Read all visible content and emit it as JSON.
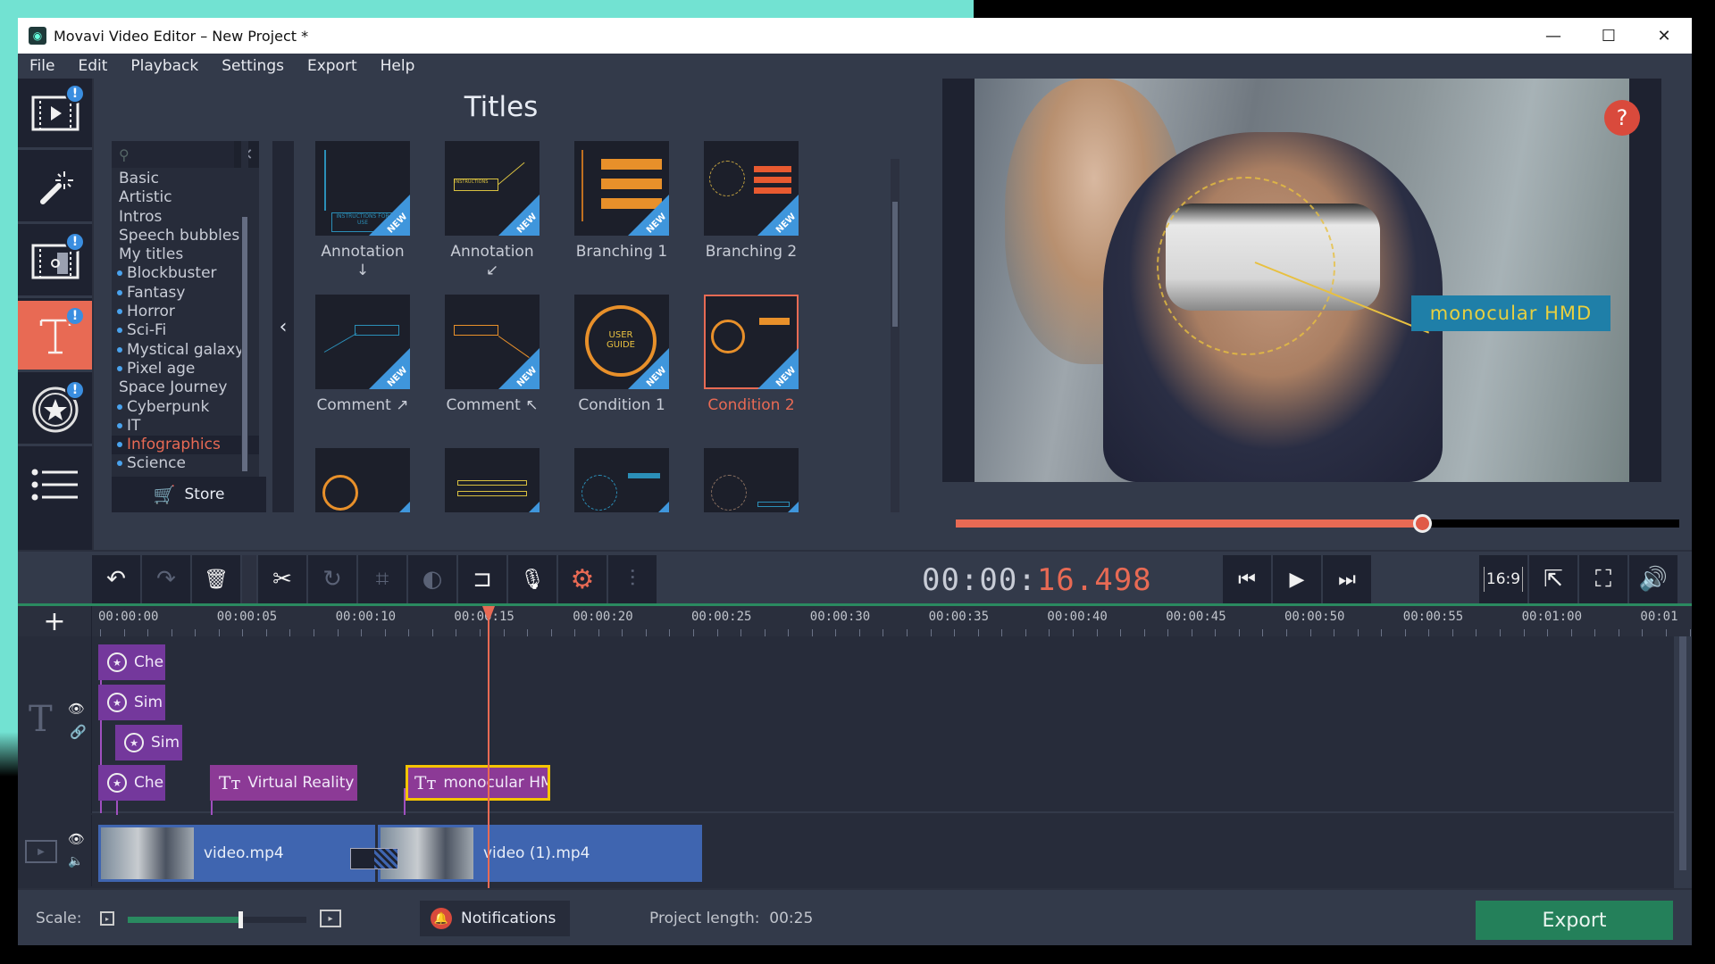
{
  "window": {
    "title": "Movavi Video Editor – New Project *",
    "controls": {
      "minimize": "—",
      "maximize": "☐",
      "close": "✕"
    }
  },
  "menu": [
    "File",
    "Edit",
    "Playback",
    "Settings",
    "Export",
    "Help"
  ],
  "sidebar": {
    "items": [
      {
        "name": "import-media",
        "icon": "film-play-icon",
        "badge": "!"
      },
      {
        "name": "filters",
        "icon": "magic-wand-icon",
        "badge": ""
      },
      {
        "name": "transitions",
        "icon": "film-puzzle-icon",
        "badge": "!"
      },
      {
        "name": "titles",
        "icon": "text-t-icon",
        "badge": "!",
        "active": true
      },
      {
        "name": "stickers",
        "icon": "star-circle-icon",
        "badge": "!"
      },
      {
        "name": "more-tools",
        "icon": "list-icon",
        "badge": ""
      }
    ]
  },
  "titles_panel": {
    "heading": "Titles",
    "search_placeholder": "",
    "categories": [
      {
        "label": "Basic",
        "dot": false
      },
      {
        "label": "Artistic",
        "dot": false
      },
      {
        "label": "Intros",
        "dot": false
      },
      {
        "label": "Speech bubbles",
        "dot": false
      },
      {
        "label": "My titles",
        "dot": false
      },
      {
        "label": "Blockbuster",
        "dot": true
      },
      {
        "label": "Fantasy",
        "dot": true
      },
      {
        "label": "Horror",
        "dot": true
      },
      {
        "label": "Sci-Fi",
        "dot": true
      },
      {
        "label": "Mystical galaxy",
        "dot": true
      },
      {
        "label": "Pixel age",
        "dot": true
      },
      {
        "label": "Space Journey",
        "dot": false
      },
      {
        "label": "Cyberpunk",
        "dot": true
      },
      {
        "label": "IT",
        "dot": true
      },
      {
        "label": "Infographics",
        "dot": true,
        "active": true
      },
      {
        "label": "Science",
        "dot": true
      }
    ],
    "store_label": "Store",
    "new_badge": "NEW",
    "tiles": [
      {
        "label": "Annotation ↓",
        "new": true
      },
      {
        "label": "Annotation ↙",
        "new": true
      },
      {
        "label": "Branching 1",
        "new": true
      },
      {
        "label": "Branching 2",
        "new": true
      },
      {
        "label": "Comment ↗",
        "new": true
      },
      {
        "label": "Comment ↖",
        "new": true
      },
      {
        "label": "Condition 1",
        "new": true
      },
      {
        "label": "Condition 2",
        "new": true,
        "selected": true
      },
      {
        "label": "",
        "new": true
      },
      {
        "label": "",
        "new": true
      },
      {
        "label": "",
        "new": true
      },
      {
        "label": "",
        "new": true
      }
    ]
  },
  "preview": {
    "overlay_text": "monocular HMD",
    "help": "?",
    "progress": 0.645
  },
  "toolbar": {
    "undo": "↶",
    "redo": "↷",
    "delete": "🗑",
    "cut": "✂",
    "rotate": "↻",
    "crop": "⌗",
    "color": "◐",
    "split": "⊐",
    "record": "🎙",
    "settings": "⚙",
    "equalizer": "⫶"
  },
  "player": {
    "time_prefix": "00:00:",
    "time_value": "16.498",
    "aspect": "16:9"
  },
  "timeline": {
    "ticks": [
      "00:00:00",
      "00:00:05",
      "00:00:10",
      "00:00:15",
      "00:00:20",
      "00:00:25",
      "00:00:30",
      "00:00:35",
      "00:00:40",
      "00:00:45",
      "00:00:50",
      "00:00:55",
      "00:01:00",
      "00:01"
    ],
    "title_clips": [
      {
        "label": "Che",
        "type": "sticker"
      },
      {
        "label": "Sim",
        "type": "sticker"
      },
      {
        "label": "Sim",
        "type": "sticker"
      },
      {
        "label": "Che",
        "type": "sticker"
      },
      {
        "label": "Virtual Reality",
        "type": "text"
      },
      {
        "label": "monocular HMD",
        "type": "text",
        "selected": true
      }
    ],
    "video_clips": [
      {
        "label": "video.mp4"
      },
      {
        "label": "video (1).mp4"
      }
    ]
  },
  "bottom": {
    "scale_label": "Scale:",
    "scale_value": 0.62,
    "notifications_label": "Notifications",
    "project_length_label": "Project length:",
    "project_length_value": "00:25",
    "export_label": "Export"
  },
  "colors": {
    "accent": "#e86a54",
    "export_green": "#24805a",
    "badge_blue": "#3a8ee0",
    "title_clip": "#74389c",
    "video_clip": "#3f65b0"
  }
}
